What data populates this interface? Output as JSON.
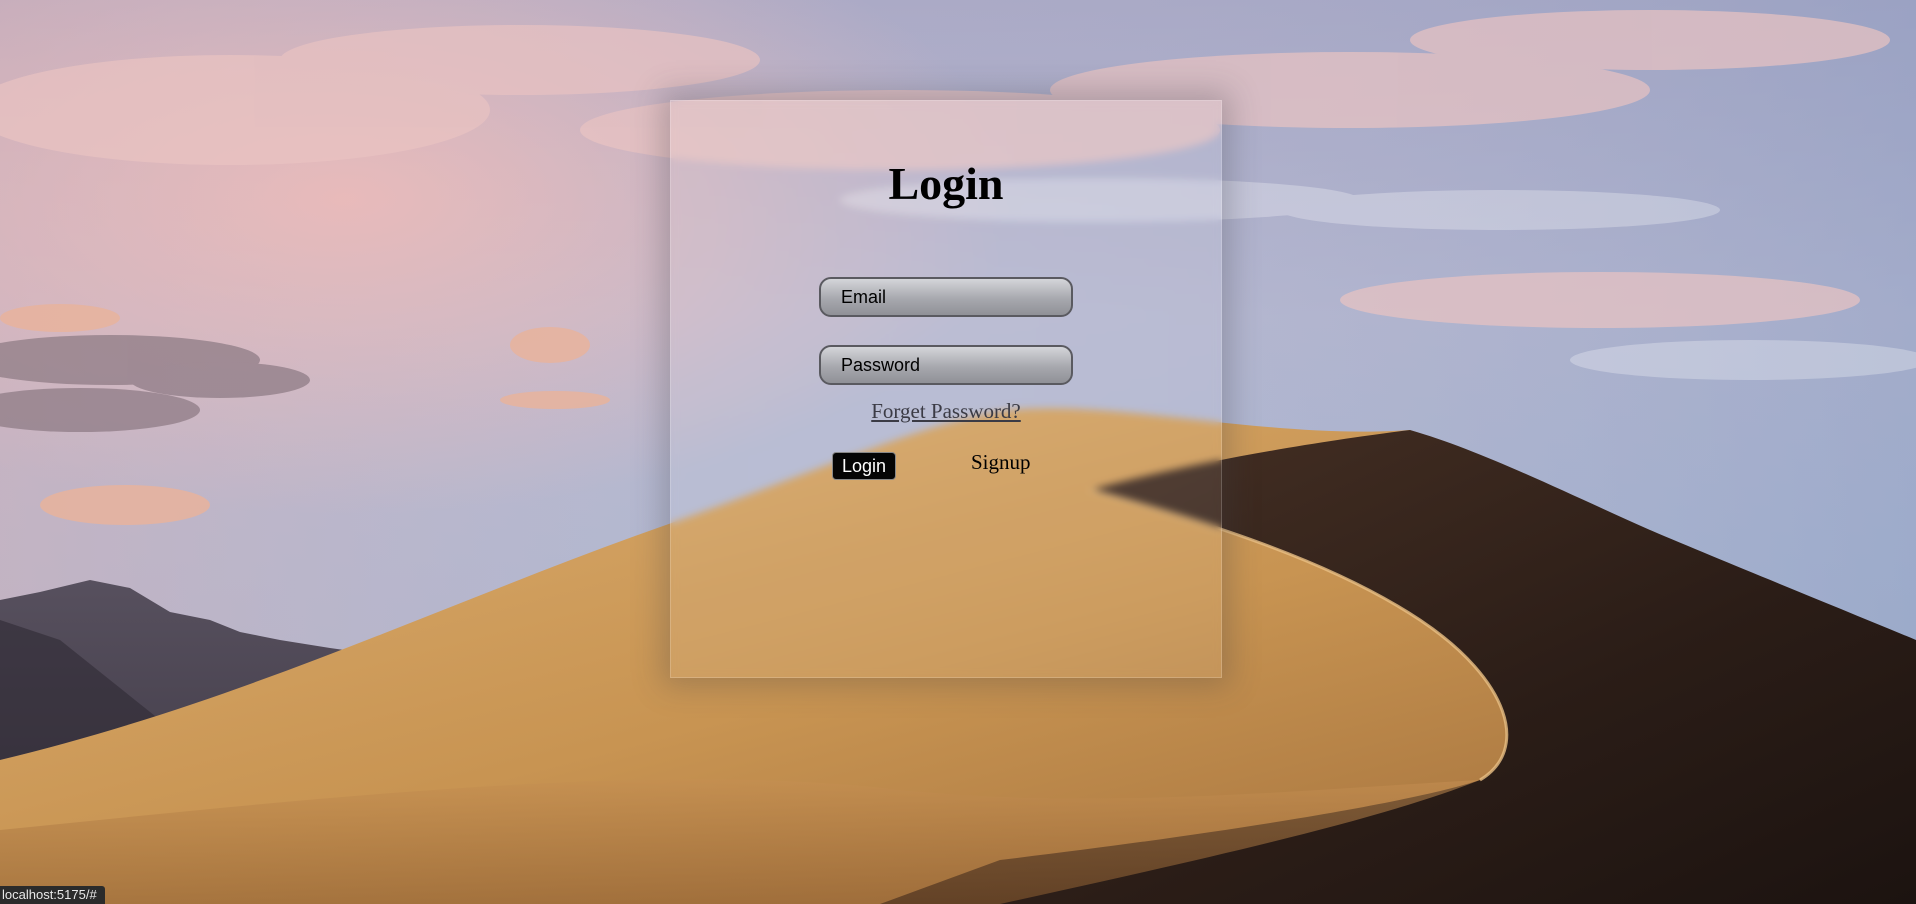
{
  "login_card": {
    "title": "Login",
    "email_placeholder": "Email",
    "password_placeholder": "Password",
    "forgot_link": "Forget Password?",
    "login_button": "Login",
    "signup_button": "Signup"
  },
  "status_bar": {
    "url": "localhost:5175/#"
  },
  "colors": {
    "login_button_bg": "#050505",
    "sky_top": "#a7a9c6",
    "dune_light": "#d1a266",
    "dune_shadow": "#2a1d18"
  }
}
